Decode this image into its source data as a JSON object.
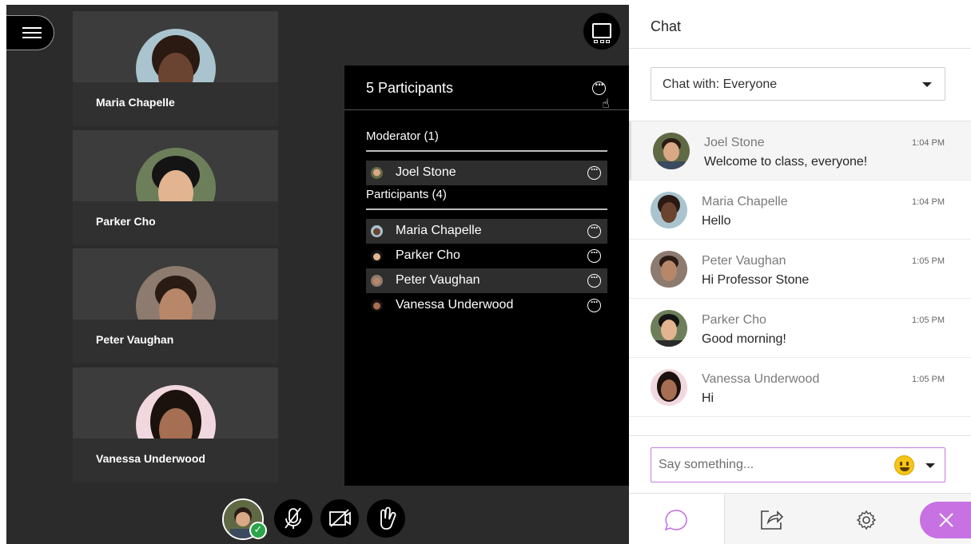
{
  "stage": {
    "tiles": [
      {
        "name": "Maria Chapelle",
        "skin": "#6b4331",
        "hair": "#2a1a12",
        "bg": "#a9c4cf"
      },
      {
        "name": "Parker Cho",
        "skin": "#e2b48f",
        "hair": "#141414",
        "bg": "#6d7f5a"
      },
      {
        "name": "Peter Vaughan",
        "skin": "#b8876a",
        "hair": "#2a1c15",
        "bg": "#8c7b6e"
      },
      {
        "name": "Vanessa Underwood",
        "skin": "#a66e52",
        "hair": "#1b120d",
        "bg": "#f1d8df"
      }
    ]
  },
  "participants": {
    "title": "5 Participants",
    "moderator_header": "Moderator (1)",
    "participants_header": "Participants (4)",
    "moderators": [
      {
        "name": "Joel Stone"
      }
    ],
    "people": [
      {
        "name": "Maria Chapelle"
      },
      {
        "name": "Parker Cho"
      },
      {
        "name": "Peter Vaughan"
      },
      {
        "name": "Vanessa Underwood"
      }
    ]
  },
  "chat": {
    "title": "Chat",
    "chat_with": "Chat with: Everyone",
    "messages": [
      {
        "name": "Joel Stone",
        "time": "1:04 PM",
        "text": "Welcome to class, everyone!"
      },
      {
        "name": "Maria Chapelle",
        "time": "1:04 PM",
        "text": "Hello"
      },
      {
        "name": "Peter Vaughan",
        "time": "1:05 PM",
        "text": "Hi Professor Stone"
      },
      {
        "name": "Parker Cho",
        "time": "1:05 PM",
        "text": "Good morning!"
      },
      {
        "name": "Vanessa Underwood",
        "time": "1:05 PM",
        "text": "Hi"
      }
    ],
    "input_placeholder": "Say something..."
  },
  "colors": {
    "accent": "#c771e3",
    "stage_bg": "#2b2b2b",
    "panel_bg": "#000000",
    "status_green": "#2ba44a"
  },
  "icons": {
    "menu": "hamburger-icon",
    "layout": "layout-icon",
    "more": "more-options-icon",
    "mic": "microphone-off-icon",
    "camera": "camera-off-icon",
    "hand": "raise-hand-icon",
    "chat": "chat-bubble-icon",
    "share": "share-content-icon",
    "settings": "gear-icon",
    "close": "close-icon",
    "emoji": "emoji-icon"
  }
}
